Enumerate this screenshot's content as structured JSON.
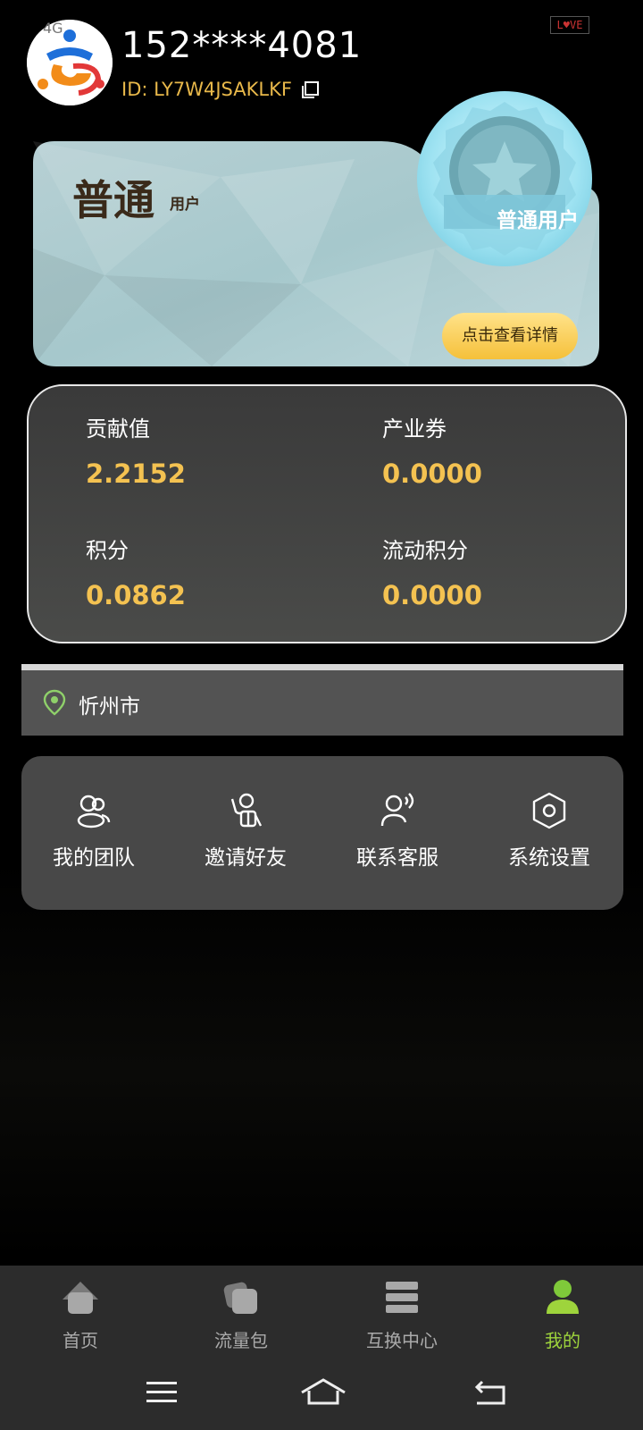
{
  "status": {
    "signal_text": "4G"
  },
  "love_mark": {
    "prefix": "L",
    "heart": "♥",
    "suffix": "VE"
  },
  "user": {
    "phone": "152****4081",
    "id_label": "ID:",
    "id_value": "LY7W4JSAKLKF"
  },
  "member_card": {
    "level_name": "普通",
    "level_suffix": "用户",
    "badge_text": "普通用户",
    "detail_button": "点击查看详情"
  },
  "stats": [
    {
      "label": "贡献值",
      "value": "2.2152"
    },
    {
      "label": "产业券",
      "value": "0.0000"
    },
    {
      "label": "积分",
      "value": "0.0862"
    },
    {
      "label": "流动积分",
      "value": "0.0000"
    }
  ],
  "location": {
    "city": "忻州市"
  },
  "services": [
    {
      "label": "我的团队",
      "icon": "team-icon"
    },
    {
      "label": "邀请好友",
      "icon": "invite-icon"
    },
    {
      "label": "联系客服",
      "icon": "customer-service-icon"
    },
    {
      "label": "系统设置",
      "icon": "settings-icon"
    }
  ],
  "tabbar": [
    {
      "label": "首页",
      "icon": "home-icon"
    },
    {
      "label": "流量包",
      "icon": "package-icon"
    },
    {
      "label": "互换中心",
      "icon": "exchange-icon"
    },
    {
      "label": "我的",
      "icon": "profile-icon",
      "active": true
    }
  ],
  "colors": {
    "accent_gold": "#f4c251",
    "active_green": "#9ed43c",
    "id_gold": "#e8b84a"
  }
}
